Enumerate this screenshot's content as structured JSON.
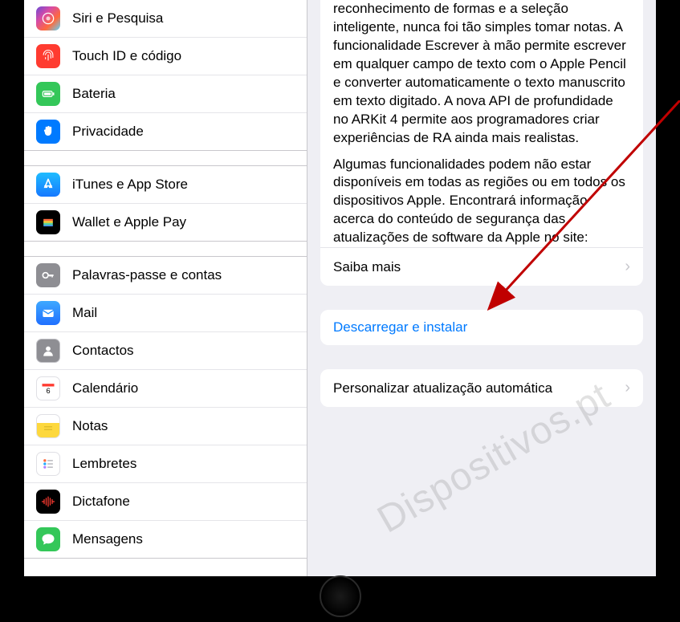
{
  "sidebar": {
    "group1": [
      {
        "label": "Siri e Pesquisa",
        "color": "#000000",
        "icon": "siri"
      },
      {
        "label": "Touch ID e código",
        "color": "#ff3b30",
        "icon": "fingerprint"
      },
      {
        "label": "Bateria",
        "color": "#34c759",
        "icon": "battery"
      },
      {
        "label": "Privacidade",
        "color": "#007aff",
        "icon": "hand"
      }
    ],
    "group2": [
      {
        "label": "iTunes e App Store",
        "color": "#1ea7fd",
        "icon": "appstore"
      },
      {
        "label": "Wallet e Apple Pay",
        "color": "#000000",
        "icon": "wallet"
      }
    ],
    "group3": [
      {
        "label": "Palavras-passe e contas",
        "color": "#8e8e93",
        "icon": "key"
      },
      {
        "label": "Mail",
        "color": "#1f8cff",
        "icon": "mail"
      },
      {
        "label": "Contactos",
        "color": "#8e8e93",
        "icon": "contacts"
      },
      {
        "label": "Calendário",
        "color": "#ffffff",
        "icon": "calendar"
      },
      {
        "label": "Notas",
        "color": "#fdd83d",
        "icon": "notes"
      },
      {
        "label": "Lembretes",
        "color": "#ffffff",
        "icon": "reminders"
      },
      {
        "label": "Dictafone",
        "color": "#000000",
        "icon": "voice"
      },
      {
        "label": "Mensagens",
        "color": "#34c759",
        "icon": "messages"
      }
    ]
  },
  "content": {
    "description1": "reconhecimento de formas e a seleção inteligente, nunca foi tão simples tomar notas. A funcionalidade Escrever à mão permite escrever em qualquer campo de texto com o Apple Pencil e converter automaticamente o texto manuscrito em texto digitado. A nova API de profundidade no ARKit 4 permite aos programadores criar experiências de RA ainda mais realistas.",
    "description2": "Algumas funcionalidades podem não estar disponíveis em todas as regiões ou em todos os dispositivos Apple. Encontrará informação acerca do conteúdo de segurança das atualizações de software da Apple no site:",
    "learn_more": "Saiba mais",
    "download_install": "Descarregar e instalar",
    "customize_auto": "Personalizar atualização automática"
  },
  "watermark": "Dispositivos.pt"
}
